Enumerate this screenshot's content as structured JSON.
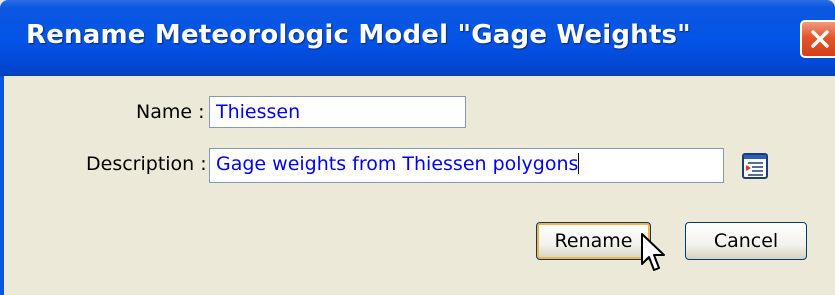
{
  "window": {
    "title": "Rename Meteorologic Model \"Gage Weights\""
  },
  "form": {
    "name_label": "Name :",
    "name_value": "Thiessen",
    "description_label": "Description :",
    "description_value": "Gage weights from Thiessen polygons"
  },
  "buttons": {
    "rename_label": "Rename",
    "cancel_label": "Cancel"
  },
  "icons": {
    "close": "close-icon",
    "description_editor": "text-editor-icon",
    "cursor": "mouse-pointer-icon"
  },
  "colors": {
    "titlebar": "#0353e6",
    "dialog_background": "#ece9d8",
    "input_text": "#0000ff",
    "default_button_highlight": "#f8b33c",
    "close_button": "#e4552c"
  }
}
